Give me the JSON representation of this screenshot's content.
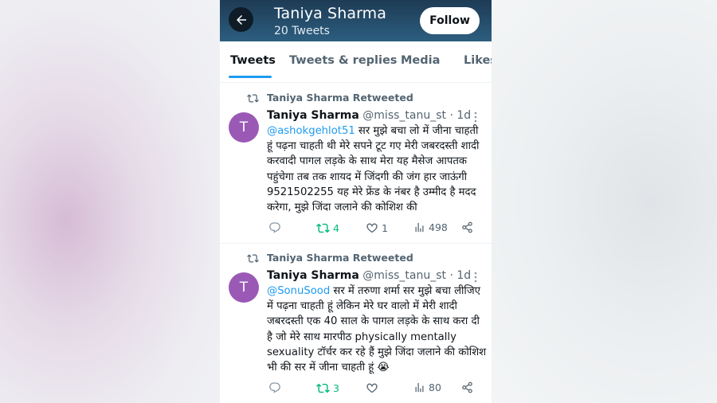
{
  "profile": {
    "name": "Taniya Sharma",
    "tweet_count": "20 Tweets",
    "follow_label": "Follow"
  },
  "tabs": [
    {
      "label": "Tweets",
      "active": true
    },
    {
      "label": "Tweets & replies",
      "active": false
    },
    {
      "label": "Media",
      "active": false
    },
    {
      "label": "Likes",
      "active": false
    }
  ],
  "tweets": [
    {
      "retweet_label": "Taniya Sharma Retweeted",
      "avatar_letter": "T",
      "name": "Taniya Sharma",
      "handle_time": "@miss_tanu_st · 1d",
      "mention": "@ashokgehlot51",
      "text": " सर मुझे बचा लो में जीना चाहती हूं पढ़ना चाहती थी मेरे सपने टूट गए मेरी जबरदस्ती शादी करवादी पागल लड़के के साथ मेरा यह मैसेज आपतक पहुंचेगा तब तक शायद में जिंदगी की जंग हार जाऊंगी 9521502255 यह मेरे फ्रेंड के नंबर है उम्मीद है मदद करेगा, मुझे जिंदा जलाने की कोशिश की",
      "retweets": "4",
      "likes": "1",
      "views": "498"
    },
    {
      "retweet_label": "Taniya Sharma Retweeted",
      "avatar_letter": "T",
      "name": "Taniya Sharma",
      "handle_time": "@miss_tanu_st · 1d",
      "mention": "@SonuSood",
      "text": " सर में तरुणा शर्मा सर मुझे बचा लीजिए में पढ़ना चाहती हूं लेकिन मेरे घर वालो में मेरी शादी जबरदस्ती एक 40 साल के पागल लड़के के साथ करा दी है जो मेरे साथ मारपीठ physically mentally sexuality टॉर्चर कर रहे हैं मुझे जिंदा जलाने की कोशिश भी की सर में जीना चाहती हूं 😭",
      "retweets": "3",
      "likes": "",
      "views": "80"
    }
  ],
  "colors": {
    "accent": "#1d9bf0",
    "retweet_green": "#00ba7c",
    "avatar": "#9b59b6",
    "header": "#26506e"
  },
  "icons": [
    "back-arrow-icon",
    "retweet-icon",
    "more-icon",
    "reply-icon",
    "like-icon",
    "views-icon",
    "share-icon"
  ]
}
